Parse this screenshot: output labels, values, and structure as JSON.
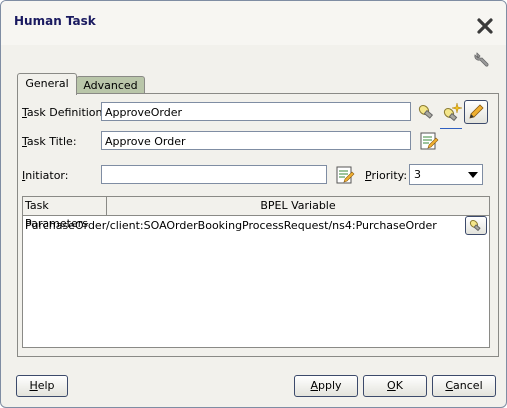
{
  "window": {
    "title": "Human Task"
  },
  "tabs": [
    {
      "label": "General",
      "active": true
    },
    {
      "label": "Advanced",
      "active": false
    }
  ],
  "form": {
    "task_definition": {
      "label_u": "T",
      "label_rest": "ask Definition:",
      "value": "ApproveOrder"
    },
    "task_title": {
      "label_u": "T",
      "label_rest": "ask Title:",
      "value": "Approve Order"
    },
    "initiator": {
      "label_u": "I",
      "label_rest": "nitiator:",
      "value": ""
    },
    "priority": {
      "label_u": "P",
      "label_rest": "riority:",
      "value": "3"
    }
  },
  "table": {
    "headers": [
      "Task Parameters",
      "BPEL Variable"
    ],
    "rows": [
      {
        "param": "PurchaseOrder",
        "variable": "/client:SOAOrderBookingProcessRequest/ns4:PurchaseOrder"
      }
    ]
  },
  "buttons": {
    "help": {
      "u": "H",
      "rest": "elp"
    },
    "apply": {
      "u": "A",
      "rest": "pply"
    },
    "ok": {
      "u": "O",
      "rest": "K"
    },
    "cancel": {
      "u": "C",
      "rest": "ancel"
    }
  },
  "icons": {
    "close": "close-icon",
    "wrench": "wrench-icon",
    "flashlight": "flashlight-icon",
    "new": "new-sparkle-icon",
    "edit": "pencil-icon",
    "edit_doc": "edit-document-icon"
  }
}
